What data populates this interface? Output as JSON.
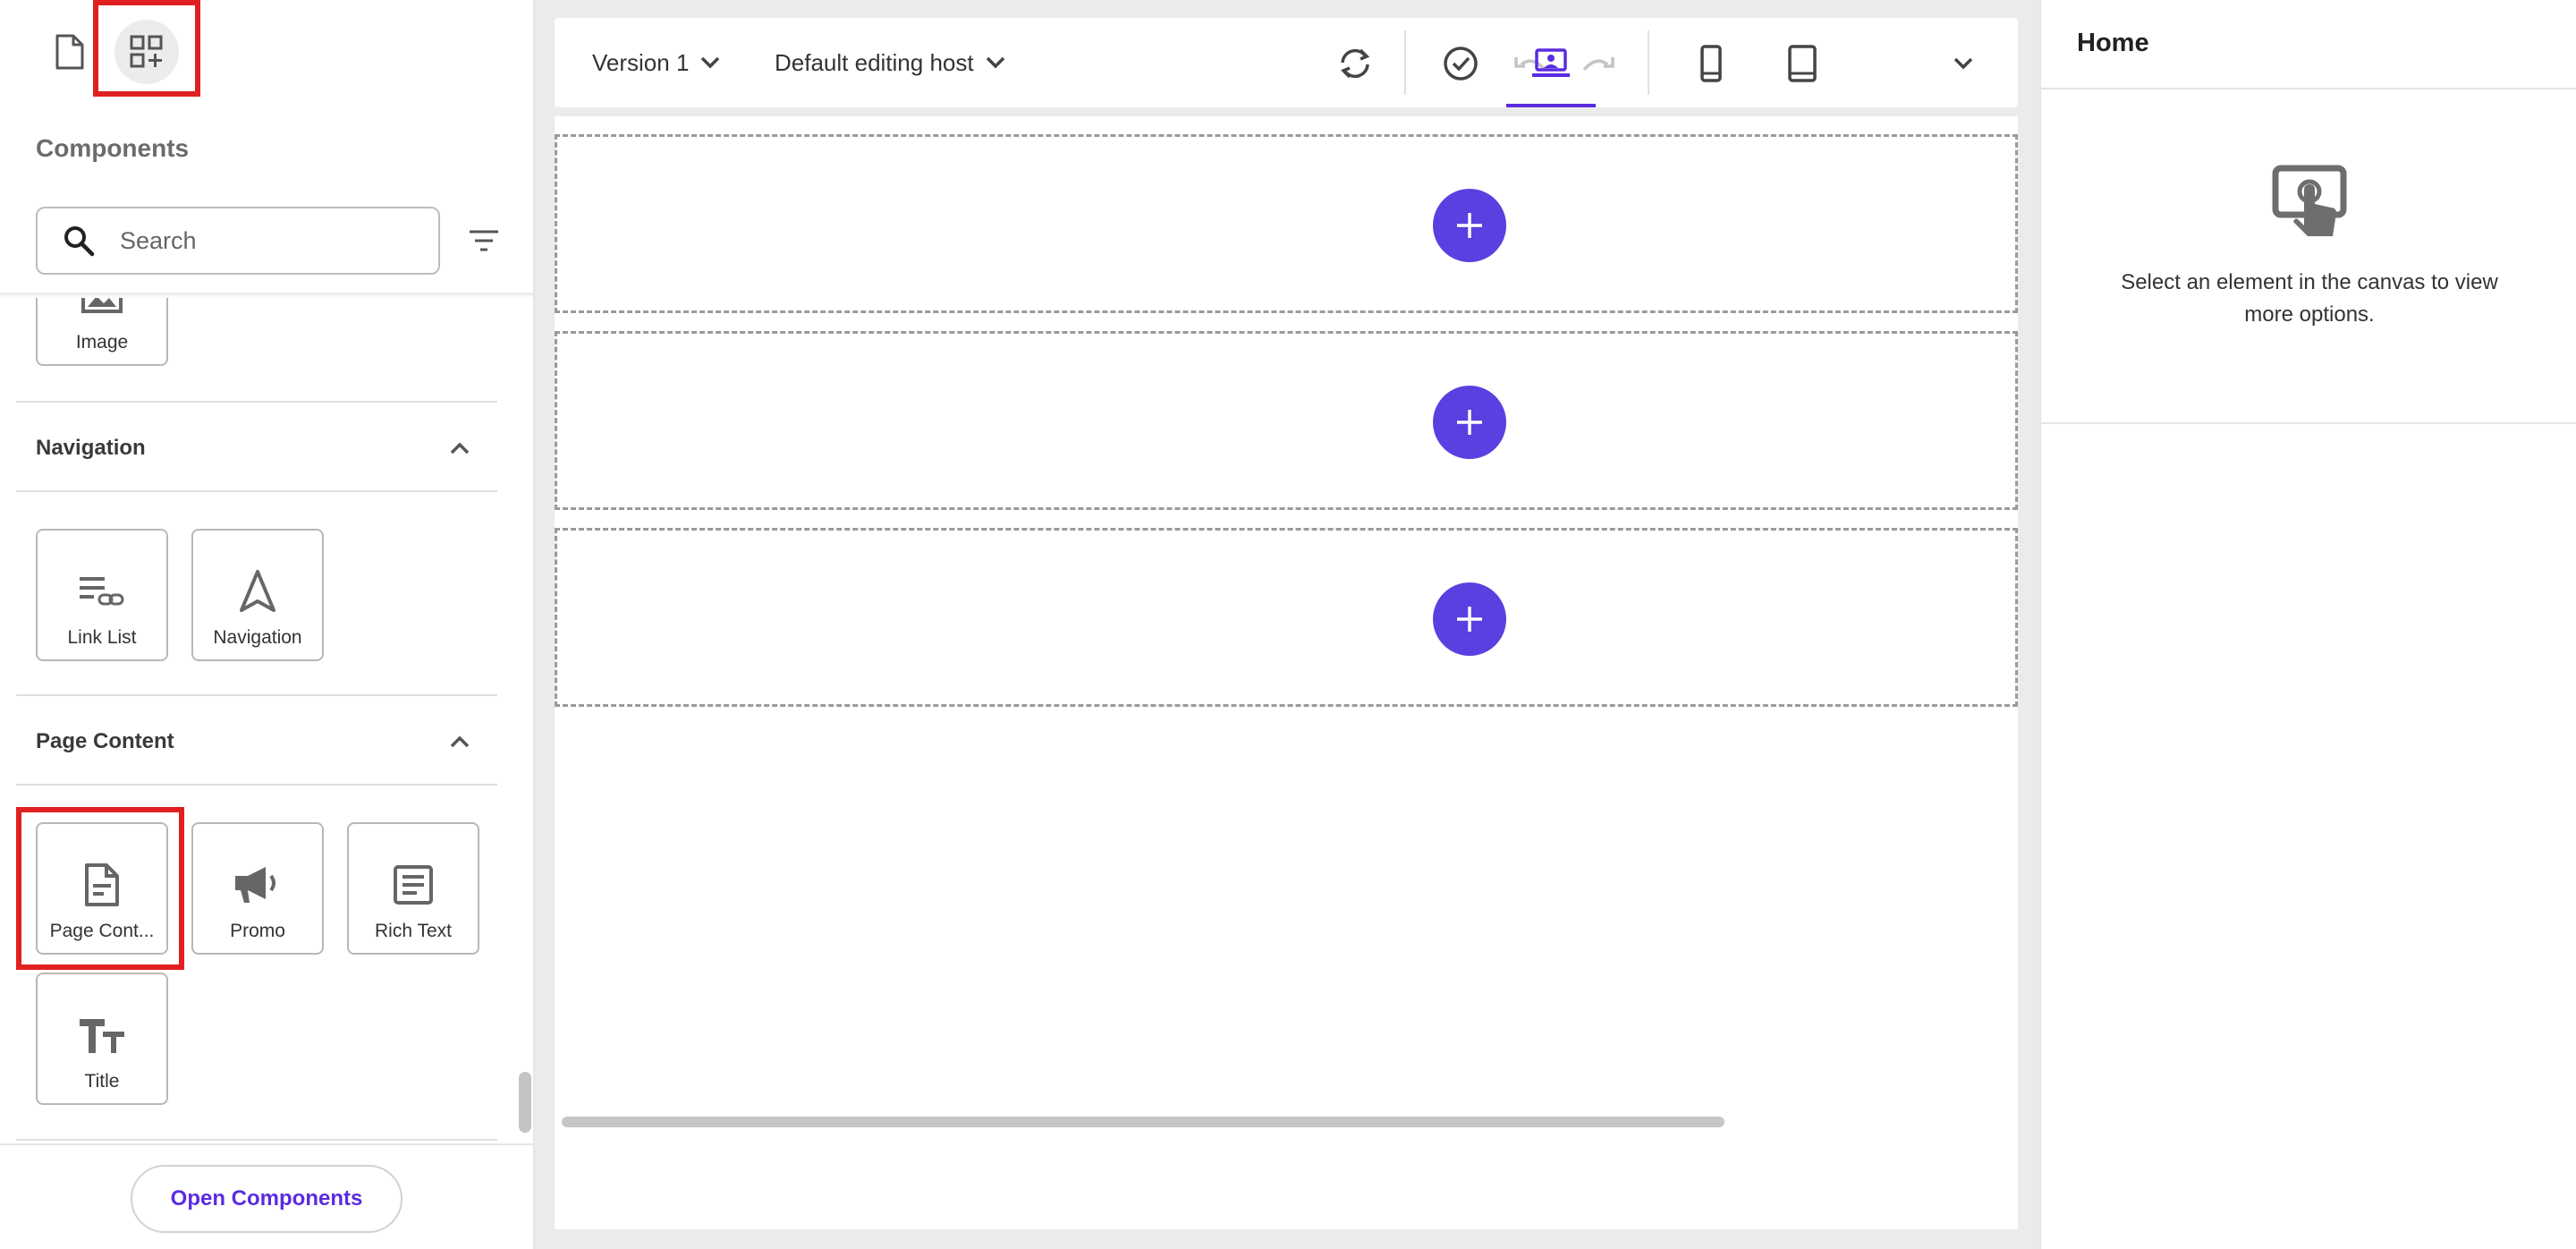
{
  "sidebar": {
    "title": "Components",
    "search_placeholder": "Search",
    "image_tile": {
      "label": "Image",
      "icon": "image-icon"
    },
    "categories": [
      {
        "name": "Navigation",
        "expanded": true,
        "items": [
          {
            "label": "Link List",
            "icon": "link-list-icon"
          },
          {
            "label": "Navigation",
            "icon": "navigation-arrow-icon"
          }
        ]
      },
      {
        "name": "Page Content",
        "expanded": true,
        "items": [
          {
            "label": "Page Cont...",
            "icon": "document-icon"
          },
          {
            "label": "Promo",
            "icon": "megaphone-icon"
          },
          {
            "label": "Rich Text",
            "icon": "rich-text-icon"
          },
          {
            "label": "Title",
            "icon": "title-text-icon"
          }
        ]
      }
    ],
    "open_button": "Open Components"
  },
  "toolbar": {
    "version": "Version 1",
    "host": "Default editing host",
    "selected_device": "desktop"
  },
  "canvas": {
    "placeholders": 3
  },
  "right_panel": {
    "title": "Home",
    "empty_message": "Select an element in the canvas to view more options."
  },
  "colors": {
    "accent": "#5b3fe0",
    "link": "#5b2be0",
    "highlight": "#e02020"
  }
}
